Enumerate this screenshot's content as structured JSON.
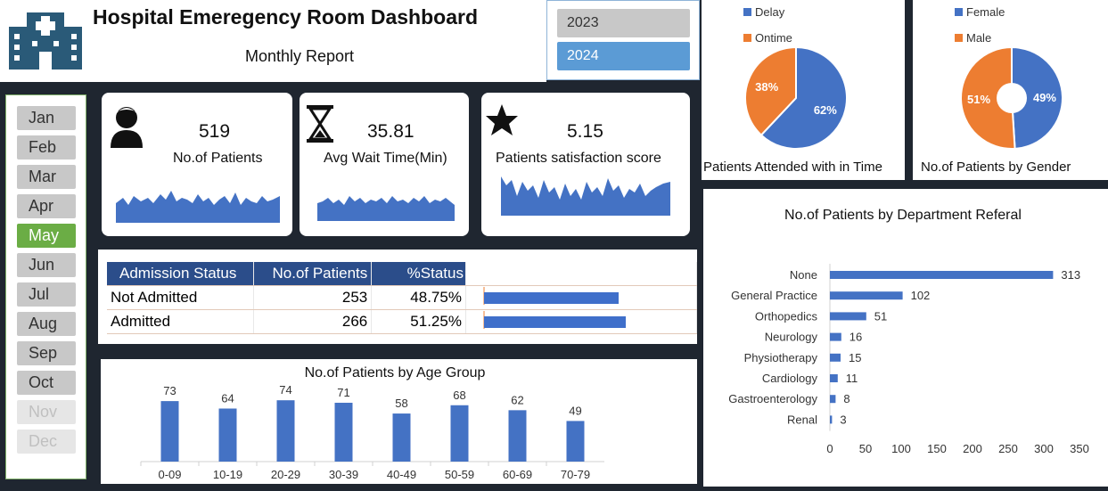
{
  "header": {
    "title": "Hospital Emeregency Room Dashboard",
    "subtitle": "Monthly Report",
    "icon": "hospital-icon"
  },
  "years": [
    {
      "label": "2023",
      "selected": false
    },
    {
      "label": "2024",
      "selected": true
    }
  ],
  "months": [
    {
      "label": "Jan",
      "state": "normal"
    },
    {
      "label": "Feb",
      "state": "normal"
    },
    {
      "label": "Mar",
      "state": "normal"
    },
    {
      "label": "Apr",
      "state": "normal"
    },
    {
      "label": "May",
      "state": "active"
    },
    {
      "label": "Jun",
      "state": "normal"
    },
    {
      "label": "Jul",
      "state": "normal"
    },
    {
      "label": "Aug",
      "state": "normal"
    },
    {
      "label": "Sep",
      "state": "normal"
    },
    {
      "label": "Oct",
      "state": "normal"
    },
    {
      "label": "Nov",
      "state": "disabled"
    },
    {
      "label": "Dec",
      "state": "disabled"
    }
  ],
  "kpis": [
    {
      "value": "519",
      "label": "No.of Patients",
      "icon": "patient-icon"
    },
    {
      "value": "35.81",
      "label": "Avg Wait Time(Min)",
      "icon": "hourglass-icon"
    },
    {
      "value": "5.15",
      "label": "Patients satisfaction score",
      "icon": "star-icon"
    }
  ],
  "admission": {
    "headers": [
      "Admission Status",
      "No.of Patients",
      "%Status"
    ],
    "rows": [
      {
        "status": "Not Admitted",
        "patients": "253",
        "pct": "48.75%",
        "fraction": 0.4875
      },
      {
        "status": "Admitted",
        "patients": "266",
        "pct": "51.25%",
        "fraction": 0.5125
      }
    ]
  },
  "colors": {
    "blue": "#4472c4",
    "orange": "#ed7d31",
    "green": "#6bad45",
    "dark": "#1f2630"
  },
  "chart_data": [
    {
      "type": "pie",
      "title": "Patients Attended with in Time",
      "labels": [
        "Delay",
        "Ontime"
      ],
      "values": [
        62,
        38
      ],
      "value_labels": [
        "62%",
        "38%"
      ],
      "colors": [
        "#4472c4",
        "#ed7d31"
      ],
      "legend": "top-left"
    },
    {
      "type": "pie",
      "title": "No.of Patients by Gender",
      "labels": [
        "Female",
        "Male"
      ],
      "values": [
        49,
        51
      ],
      "value_labels": [
        "49%",
        "51%"
      ],
      "colors": [
        "#4472c4",
        "#ed7d31"
      ],
      "legend": "top-left"
    },
    {
      "type": "bar",
      "title": "No.of Patients by Age Group",
      "categories": [
        "0-09",
        "10-19",
        "20-29",
        "30-39",
        "40-49",
        "50-59",
        "60-69",
        "70-79"
      ],
      "values": [
        73,
        64,
        74,
        71,
        58,
        68,
        62,
        49
      ],
      "color": "#4472c4"
    },
    {
      "type": "bar",
      "orientation": "horizontal",
      "title": "No.of Patients by Department Referal",
      "categories": [
        "None",
        "General Practice",
        "Orthopedics",
        "Neurology",
        "Physiotherapy",
        "Cardiology",
        "Gastroenterology",
        "Renal"
      ],
      "values": [
        313,
        102,
        51,
        16,
        15,
        11,
        8,
        3
      ],
      "xlim": [
        0,
        350
      ],
      "xticks": [
        "0",
        "50",
        "100",
        "150",
        "200",
        "250",
        "300",
        "350"
      ],
      "color": "#4472c4"
    }
  ]
}
